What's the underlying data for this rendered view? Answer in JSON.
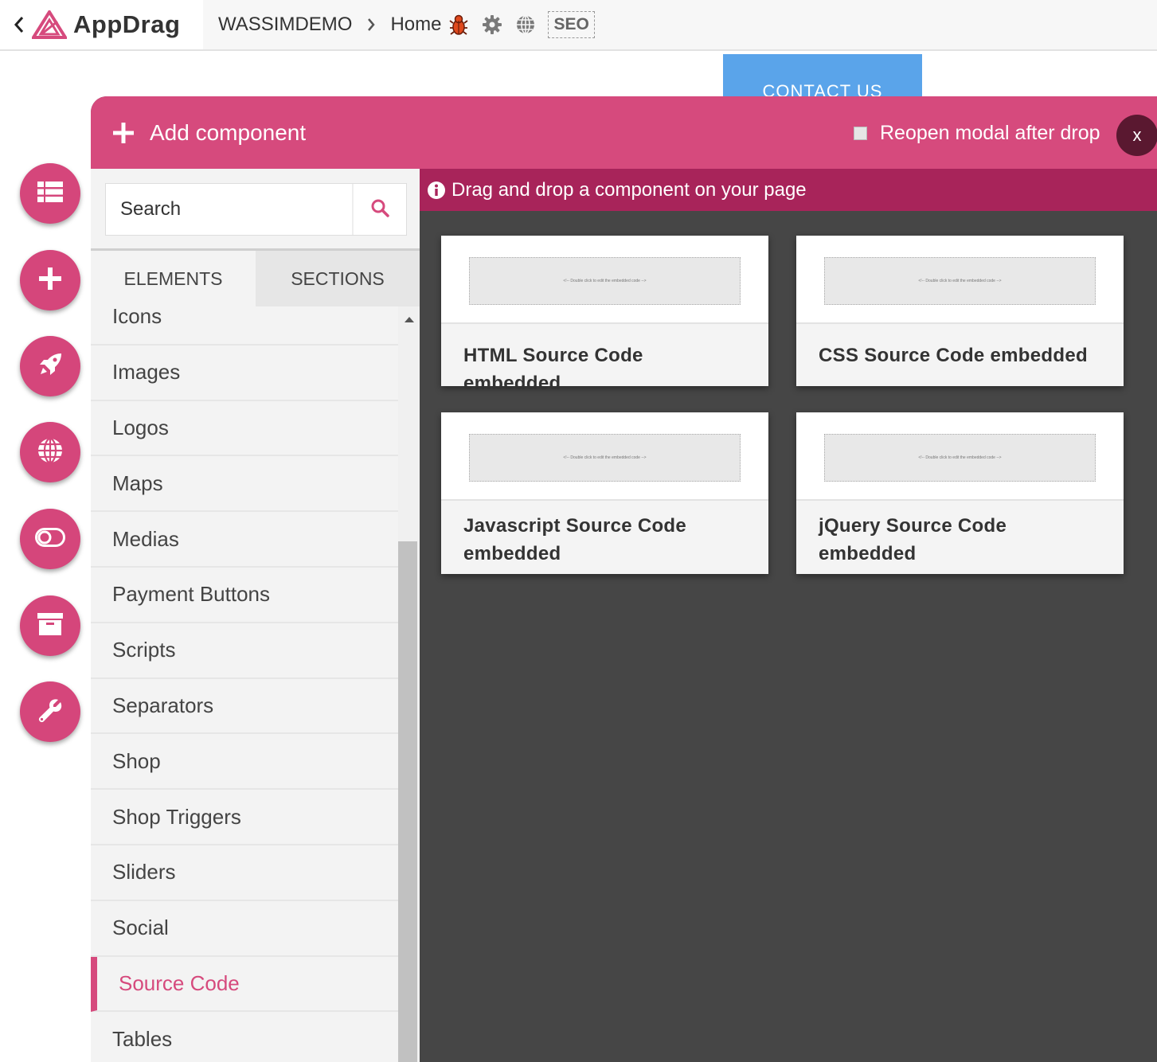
{
  "topbar": {
    "brand": "AppDrag",
    "breadcrumb": [
      "WASSIMDEMO",
      "Home"
    ],
    "seo_label": "SEO"
  },
  "background": {
    "contact_button": "CONTACT US"
  },
  "modal": {
    "title": "Add component",
    "reopen_label": "Reopen modal after drop",
    "close_label": "x",
    "search_placeholder": "Search",
    "tabs": [
      "ELEMENTS",
      "SECTIONS"
    ],
    "active_tab": "ELEMENTS",
    "categories": [
      "Icons",
      "Images",
      "Logos",
      "Maps",
      "Medias",
      "Payment Buttons",
      "Scripts",
      "Separators",
      "Shop",
      "Shop Triggers",
      "Sliders",
      "Social",
      "Source Code",
      "Tables"
    ],
    "active_category": "Source Code",
    "info_text": "Drag and drop a component on your page",
    "components": [
      {
        "label": "HTML Source Code embedded",
        "placeholder": "<!-- Double click to edit the embedded code -->"
      },
      {
        "label": "CSS Source Code embedded",
        "placeholder": "<!-- Double click to edit the embedded code -->"
      },
      {
        "label": "Javascript Source Code embedded",
        "placeholder": "<!-- Double click to edit the embedded code -->"
      },
      {
        "label": "jQuery Source Code embedded",
        "placeholder": "<!-- Double click to edit the embedded code -->"
      }
    ]
  },
  "side_toolbar": [
    "list-icon",
    "plus-icon",
    "rocket-icon",
    "globe-icon",
    "toggle-icon",
    "archive-icon",
    "wrench-icon"
  ],
  "colors": {
    "accent": "#d64a7d",
    "accent_dark": "#a8245a",
    "panel_bg": "#464646",
    "contact_blue": "#5aa4ea"
  }
}
